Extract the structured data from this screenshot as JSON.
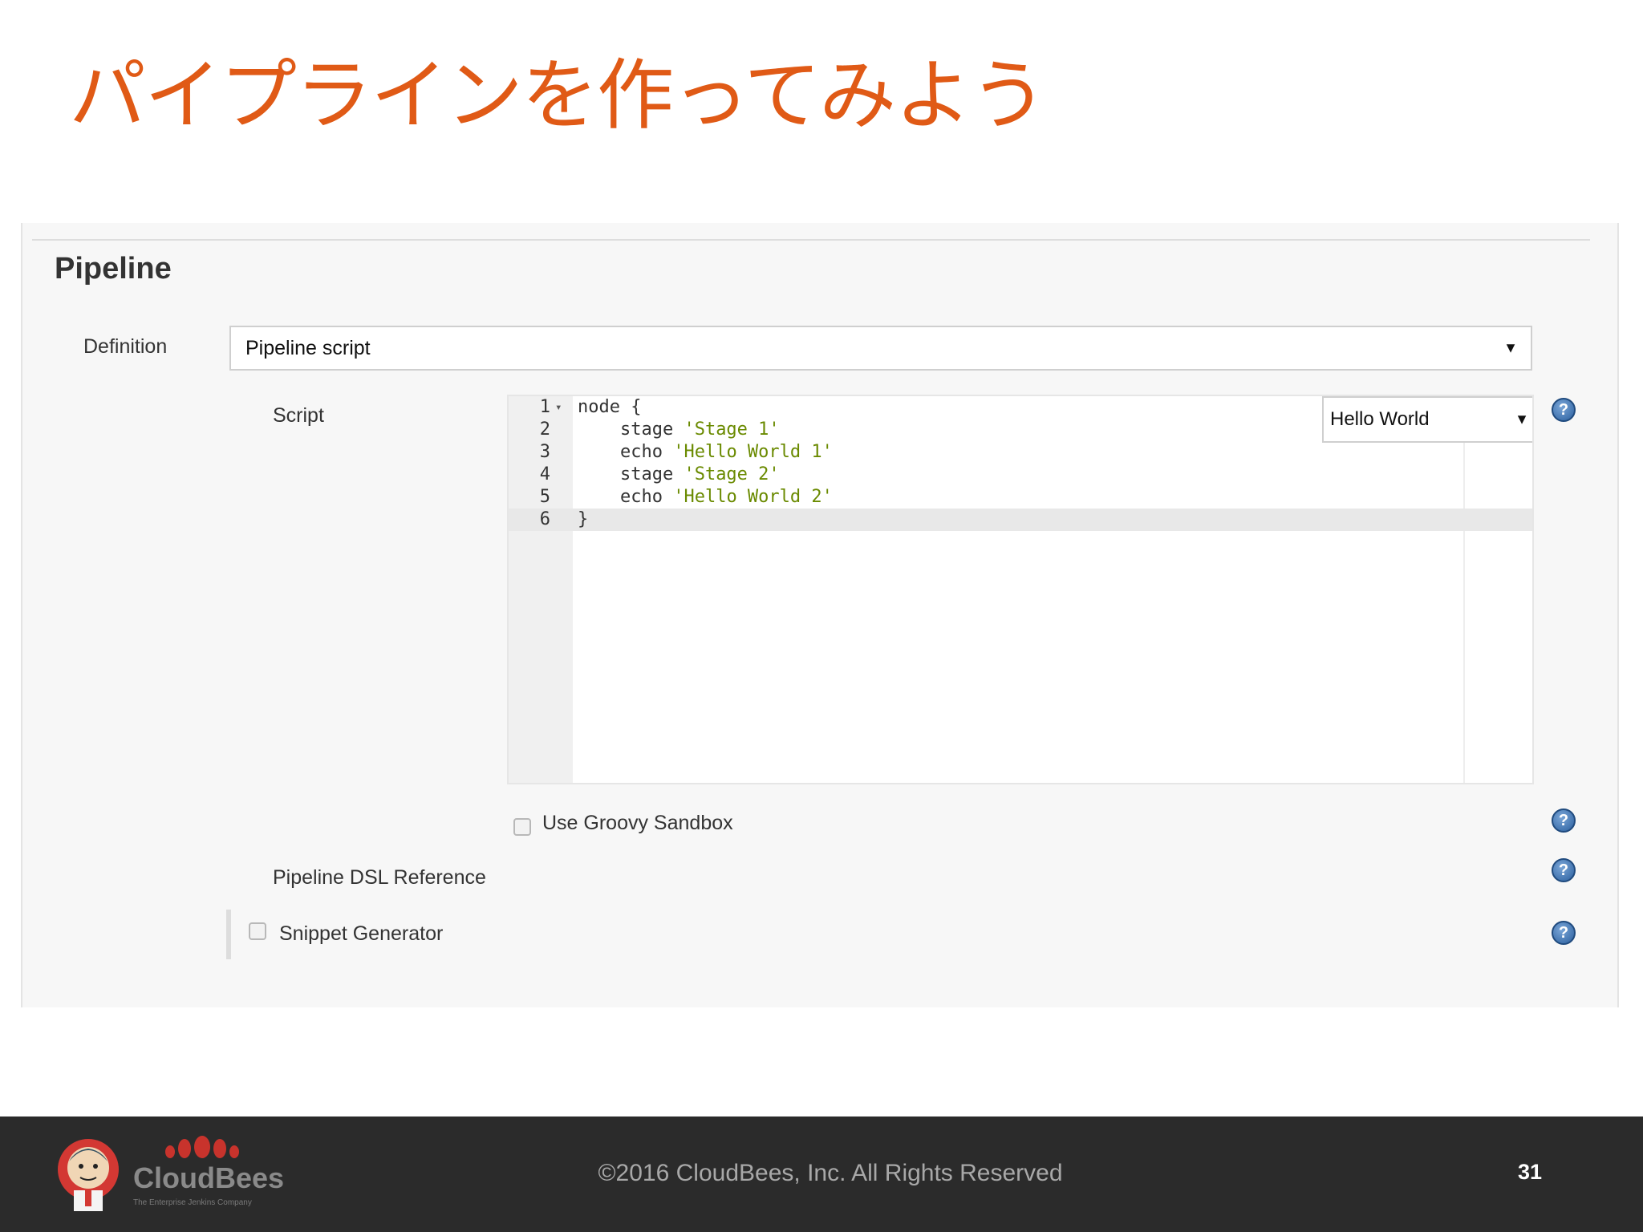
{
  "slide": {
    "title": "パイプラインを作ってみよう",
    "page_number": "31",
    "copyright": "©2016 CloudBees, Inc. All Rights Reserved"
  },
  "logo": {
    "name": "CloudBees",
    "tagline": "The Enterprise Jenkins Company"
  },
  "pipeline": {
    "heading": "Pipeline",
    "definition_label": "Definition",
    "definition_value": "Pipeline script",
    "script_label": "Script",
    "sample_value": "Hello World",
    "code_lines": [
      {
        "n": "1",
        "kw": "node {",
        "str": ""
      },
      {
        "n": "2",
        "kw": "    stage ",
        "str": "'Stage 1'"
      },
      {
        "n": "3",
        "kw": "    echo ",
        "str": "'Hello World 1'"
      },
      {
        "n": "4",
        "kw": "    stage ",
        "str": "'Stage 2'"
      },
      {
        "n": "5",
        "kw": "    echo ",
        "str": "'Hello World 2'"
      },
      {
        "n": "6",
        "kw": "}",
        "str": ""
      }
    ],
    "sandbox_label": "Use Groovy Sandbox",
    "dsl_reference_label": "Pipeline DSL Reference",
    "snippet_generator_label": "Snippet Generator",
    "help_glyph": "?",
    "dropdown_glyph": "▼",
    "fold_glyph": "▾"
  },
  "colors": {
    "title": "#e05a16",
    "string": "#6a8a00",
    "footer_bg": "#2b2b2b",
    "help_icon": "#2b5f9e"
  }
}
